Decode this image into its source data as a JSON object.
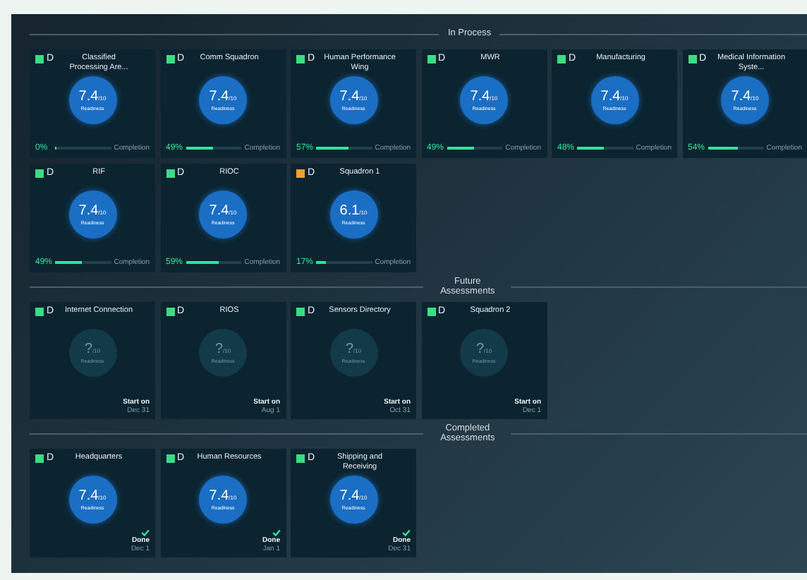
{
  "sections": [
    {
      "title": "In Process",
      "cards": [
        {
          "kind": "progress",
          "name": "Classified Processing Are...",
          "color": "#3ddc84",
          "letter": "D",
          "score": "7.4",
          "out_of": "/10",
          "score_label": "Readiness",
          "percent": "0%",
          "level": 0,
          "progress_label": "Completion"
        },
        {
          "kind": "progress",
          "name": "Comm Squadron",
          "color": "#3ddc84",
          "letter": "D",
          "score": "7.4",
          "out_of": "/10",
          "score_label": "Readiness",
          "percent": "49%",
          "level": 0.49,
          "progress_label": "Completion"
        },
        {
          "kind": "progress",
          "name": "Human Performance Wing",
          "color": "#3ddc84",
          "letter": "D",
          "score": "7.4",
          "out_of": "/10",
          "score_label": "Readiness",
          "percent": "57%",
          "level": 0.57,
          "progress_label": "Completion"
        },
        {
          "kind": "progress",
          "name": "MWR",
          "color": "#3ddc84",
          "letter": "D",
          "score": "7.4",
          "out_of": "/10",
          "score_label": "Readiness",
          "percent": "49%",
          "level": 0.49,
          "progress_label": "Completion"
        },
        {
          "kind": "progress",
          "name": "Manufacturing",
          "color": "#3ddc84",
          "letter": "D",
          "score": "7.4",
          "out_of": "/10",
          "score_label": "Readiness",
          "percent": "48%",
          "level": 0.48,
          "progress_label": "Completion"
        },
        {
          "kind": "progress",
          "name": "Medical Information Syste...",
          "color": "#3ddc84",
          "letter": "D",
          "score": "7.4",
          "out_of": "/10",
          "score_label": "Readiness",
          "percent": "54%",
          "level": 0.54,
          "progress_label": "Completion"
        },
        {
          "kind": "progress",
          "name": "RIF",
          "color": "#3ddc84",
          "letter": "D",
          "score": "7.4",
          "out_of": "/10",
          "score_label": "Readiness",
          "percent": "49%",
          "level": 0.49,
          "progress_label": "Completion"
        },
        {
          "kind": "progress",
          "name": "RIOC",
          "color": "#3ddc84",
          "letter": "D",
          "score": "7.4",
          "out_of": "/10",
          "score_label": "Readiness",
          "percent": "59%",
          "level": 0.59,
          "progress_label": "Completion"
        },
        {
          "kind": "progress",
          "name": "Squadron 1",
          "color": "#f0a030",
          "letter": "D",
          "score": "6.1",
          "out_of": "/10",
          "score_label": "Readiness",
          "percent": "17%",
          "level": 0.17,
          "progress_label": "Completion"
        }
      ]
    },
    {
      "title": "Future Assessments",
      "cards": [
        {
          "kind": "future",
          "name": "Internet Connection",
          "color": "#3ddc84",
          "letter": "D",
          "score": "?",
          "out_of": "/10",
          "score_label": "Readiness",
          "status": "Start on",
          "date": "Dec 31"
        },
        {
          "kind": "future",
          "name": "RIOS",
          "color": "#3ddc84",
          "letter": "D",
          "score": "?",
          "out_of": "/10",
          "score_label": "Readiness",
          "status": "Start on",
          "date": "Aug 1"
        },
        {
          "kind": "future",
          "name": "Sensors Directory",
          "color": "#3ddc84",
          "letter": "D",
          "score": "?",
          "out_of": "/10",
          "score_label": "Readiness",
          "status": "Start on",
          "date": "Oct 31"
        },
        {
          "kind": "future",
          "name": "Squadron 2",
          "color": "#3ddc84",
          "letter": "D",
          "score": "?",
          "out_of": "/10",
          "score_label": "Readiness",
          "status": "Start on",
          "date": "Dec 1"
        }
      ]
    },
    {
      "title": "Completed Assessments",
      "cards": [
        {
          "kind": "done",
          "name": "Headquarters",
          "color": "#3ddc84",
          "letter": "D",
          "score": "7.4",
          "out_of": "/10",
          "score_label": "Readiness",
          "status": "Done",
          "date": "Dec 1"
        },
        {
          "kind": "done",
          "name": "Human Resources",
          "color": "#3ddc84",
          "letter": "D",
          "score": "7.4",
          "out_of": "/10",
          "score_label": "Readiness",
          "status": "Done",
          "date": "Jan 1"
        },
        {
          "kind": "done",
          "name": "Shipping and Receiving",
          "color": "#3ddc84",
          "letter": "D",
          "score": "7.4",
          "out_of": "/10",
          "score_label": "Readiness",
          "status": "Done",
          "date": "Dec 31"
        }
      ]
    }
  ]
}
